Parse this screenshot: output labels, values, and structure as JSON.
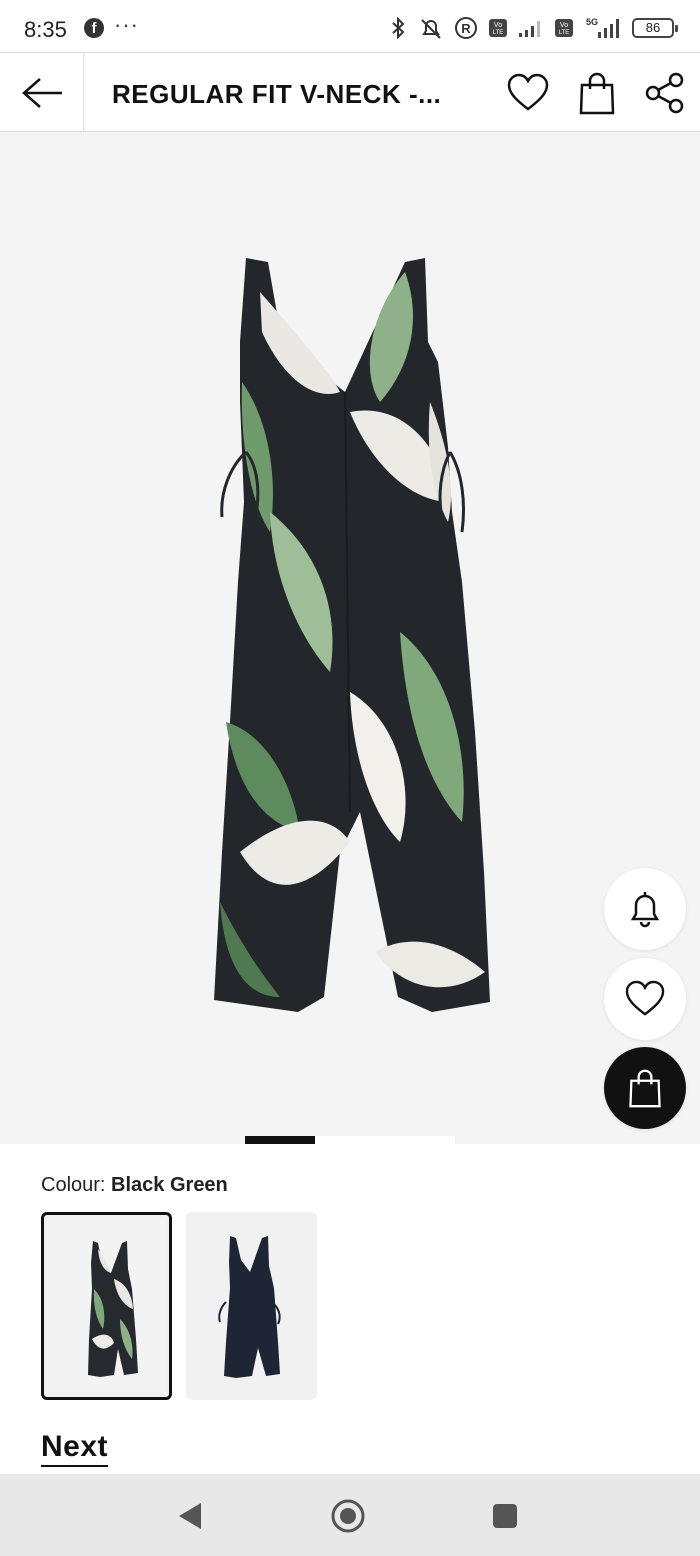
{
  "status_bar": {
    "time": "8:35",
    "dots": "···",
    "battery": "86",
    "network_label": "5G",
    "icons": [
      "facebook-icon",
      "bluetooth-icon",
      "mute-icon",
      "registered-icon",
      "volte-icon",
      "signal-icon",
      "volte-icon",
      "5g-signal-icon",
      "battery-icon"
    ]
  },
  "header": {
    "title": "REGULAR FIT  V-NECK -...",
    "icons": [
      "back-arrow-icon",
      "heart-icon",
      "shopping-bag-icon",
      "share-icon"
    ]
  },
  "gallery": {
    "image_alt": "Black green leaf print sleeveless jumpsuit",
    "pager": {
      "count": 3,
      "active_index": 0
    },
    "fabs": [
      "bell-icon",
      "heart-icon",
      "shopping-bag-icon"
    ]
  },
  "colour": {
    "label": "Colour:",
    "value": "Black Green",
    "swatches": [
      {
        "name": "Black Green",
        "selected": true
      },
      {
        "name": "Navy",
        "selected": false
      }
    ]
  },
  "brand": {
    "name": "Next"
  },
  "nav_bar": {
    "icons": [
      "back-triangle-icon",
      "home-circle-icon",
      "recents-square-icon"
    ]
  },
  "colors": {
    "accent": "#111111",
    "gallery_bg": "#f4f4f4",
    "navbar_bg": "#e8e8e8"
  }
}
